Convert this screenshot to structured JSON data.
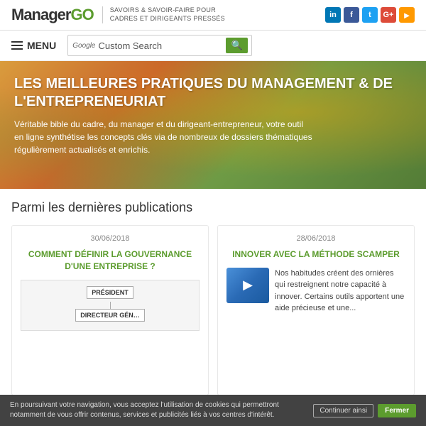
{
  "header": {
    "logo_text": "Manager",
    "logo_suffix": "GO",
    "tagline_line1": "SAVOIRS & SAVOIR-FAIRE POUR",
    "tagline_line2": "CADRES ET DIRIGEANTS PRESSÉS",
    "social": [
      {
        "name": "linkedin",
        "label": "in",
        "class": "si-linkedin"
      },
      {
        "name": "facebook",
        "label": "f",
        "class": "si-facebook"
      },
      {
        "name": "twitter",
        "label": "t",
        "class": "si-twitter"
      },
      {
        "name": "google",
        "label": "G+",
        "class": "si-google"
      },
      {
        "name": "rss",
        "label": "✦",
        "class": "si-rss"
      }
    ]
  },
  "navbar": {
    "menu_label": "Menu",
    "search_placeholder": "Custom Search",
    "google_label": "Google",
    "search_btn_icon": "🔍"
  },
  "hero": {
    "title": "Les meilleures pratiques du management & de l'entrepreneuriat",
    "description": "Véritable bible du cadre, du manager et du dirigeant-entrepreneur, votre outil en ligne synthétise les concepts clés via de nombreux de dossiers thématiques régulièrement actualisés et enrichis."
  },
  "main": {
    "section_title": "Parmi les dernières publications",
    "cards": [
      {
        "date": "30/06/2018",
        "title": "COMMENT DÉFINIR LA GOUVERNANCE D'UNE ENTREPRISE ?",
        "org_president": "PRÉSIDENT",
        "org_director": "DIRECTEUR GÉN…"
      },
      {
        "date": "28/06/2018",
        "title": "Innover avec la méthode SCAMPER",
        "body": "Nos habitudes créent des ornières qui restreignent notre capacité à innover. Certains outils apportent une aide précieuse et une..."
      }
    ]
  },
  "cookie_bar": {
    "text": "En poursuivant votre navigation, vous acceptez l'utilisation de cookies qui permettront notamment de vous offrir contenus, services et publicités liés à vos centres d'intérêt.",
    "params_label": "Continuer ainsi",
    "close_label": "Fermer"
  }
}
